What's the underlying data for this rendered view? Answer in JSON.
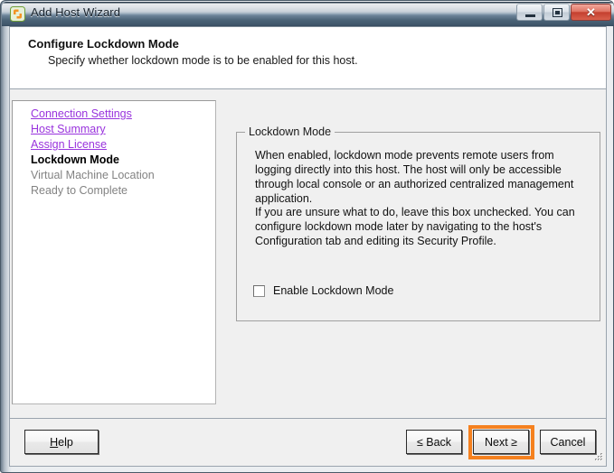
{
  "window": {
    "title": "Add Host Wizard",
    "icon": "vsphere-host-icon",
    "controls": {
      "minimize": "minimize-icon",
      "maximize": "maximize-icon",
      "close": "✕"
    }
  },
  "header": {
    "title": "Configure Lockdown Mode",
    "subtitle": "Specify whether lockdown mode is to be enabled for this host."
  },
  "sidebar": {
    "items": [
      {
        "label": "Connection Settings",
        "state": "link"
      },
      {
        "label": "Host Summary",
        "state": "link"
      },
      {
        "label": "Assign License",
        "state": "link"
      },
      {
        "label": "Lockdown Mode",
        "state": "current"
      },
      {
        "label": "Virtual Machine Location",
        "state": "future"
      },
      {
        "label": "Ready to Complete",
        "state": "future"
      }
    ]
  },
  "main": {
    "groupbox_title": "Lockdown Mode",
    "paragraph1": "When enabled, lockdown mode prevents remote users from logging directly into this host. The host will only be accessible through local console or an authorized centralized management application.",
    "paragraph2": "If you are unsure what to do, leave this box unchecked. You can configure lockdown mode later by navigating to the host's Configuration tab and editing its Security Profile.",
    "checkbox": {
      "label": "Enable Lockdown Mode",
      "checked": false
    }
  },
  "footer": {
    "help_label": "Help",
    "back_label": "≤ Back",
    "next_label": "Next ≥",
    "cancel_label": "Cancel"
  },
  "annotation": {
    "highlight_target": "next-button",
    "highlight_color": "#f5811f"
  }
}
